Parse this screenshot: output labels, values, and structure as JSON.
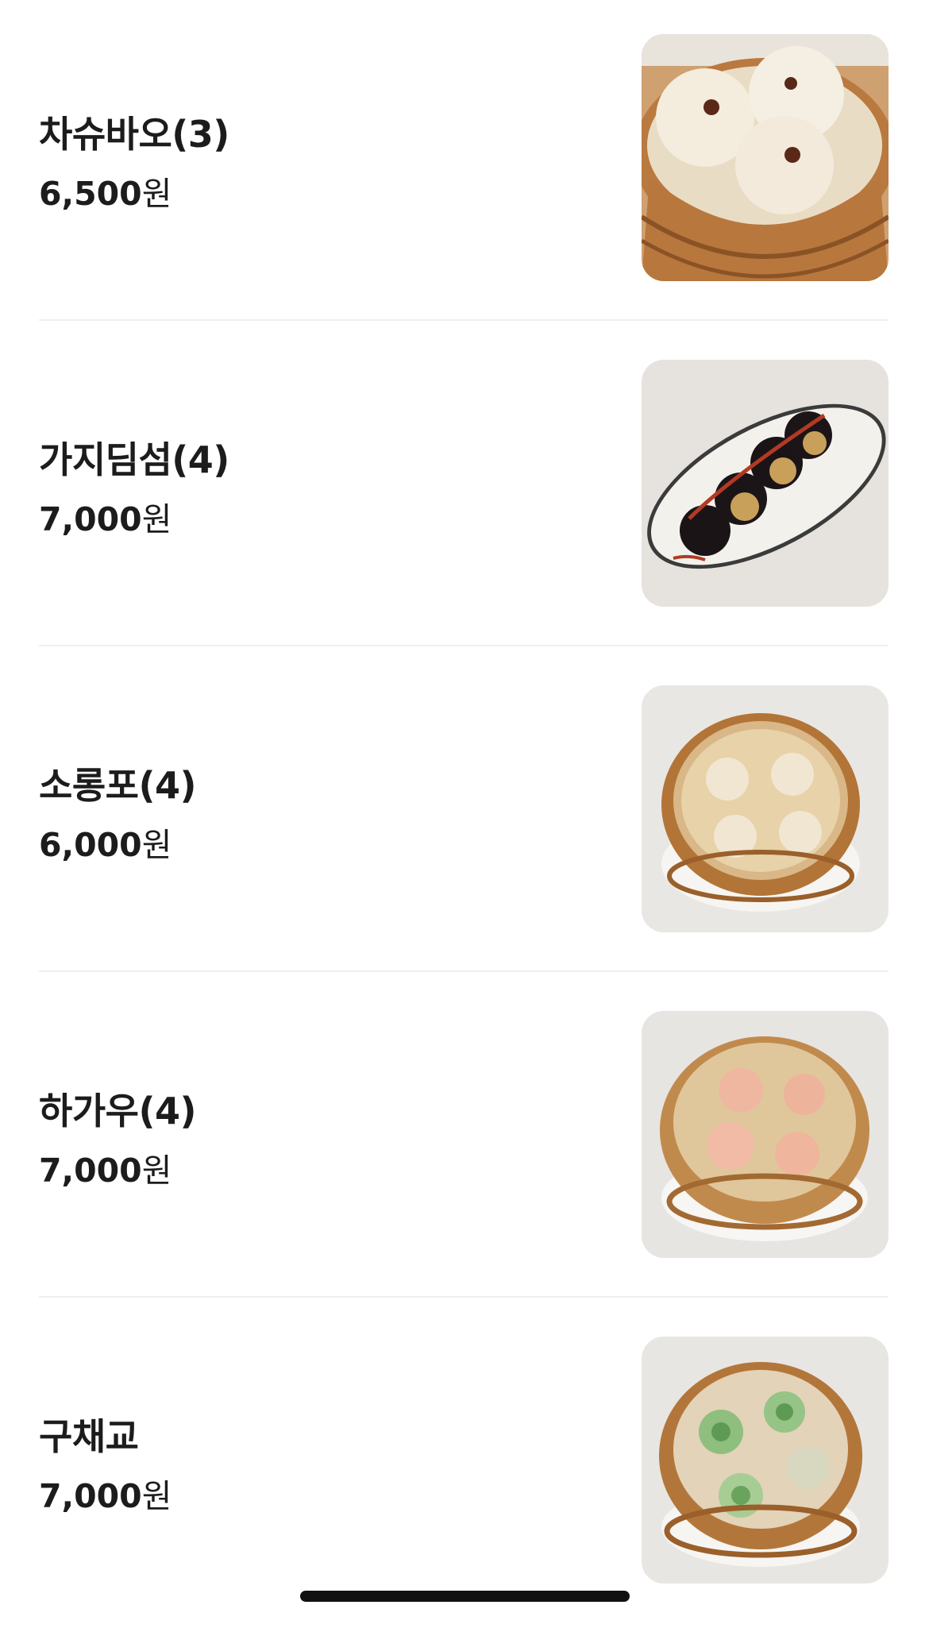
{
  "currency_suffix": "원",
  "items": [
    {
      "name": "차슈바오(3)",
      "price": "6,500",
      "image": "char-siu-bao-photo"
    },
    {
      "name": "가지딤섬(4)",
      "price": "7,000",
      "image": "eggplant-dimsum-photo"
    },
    {
      "name": "소롱포(4)",
      "price": "6,000",
      "image": "xiaolongbao-photo"
    },
    {
      "name": "하가우(4)",
      "price": "7,000",
      "image": "har-gow-photo"
    },
    {
      "name": "구채교",
      "price": "7,000",
      "image": "chive-dumpling-photo"
    }
  ]
}
